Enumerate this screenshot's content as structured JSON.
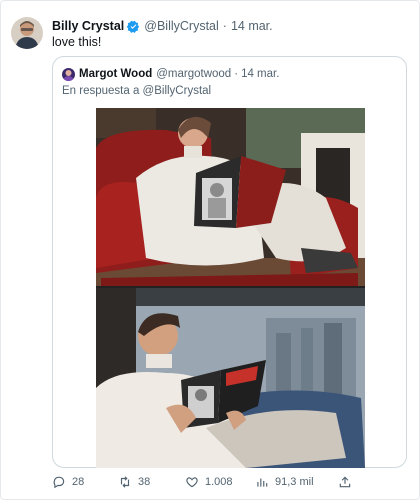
{
  "tweet": {
    "author_name": "Billy Crystal",
    "handle": "@BillyCrystal",
    "separator": "·",
    "date": "14 mar.",
    "text": "love this!"
  },
  "quoted_tweet": {
    "author_name": "Margot Wood",
    "handle": "@margotwood",
    "separator": "·",
    "date": "14 mar.",
    "reply_to": "En respuesta a @BillyCrystal"
  },
  "actions": {
    "replies": "28",
    "retweets": "38",
    "likes": "1.008",
    "views": "91,3 mil"
  },
  "colors": {
    "verified": "#1d9bf0",
    "muted_text": "#536471",
    "border": "#cfd9de"
  },
  "icons": [
    "verified-badge-icon",
    "reply-icon",
    "retweet-icon",
    "like-icon",
    "views-icon",
    "share-icon"
  ]
}
